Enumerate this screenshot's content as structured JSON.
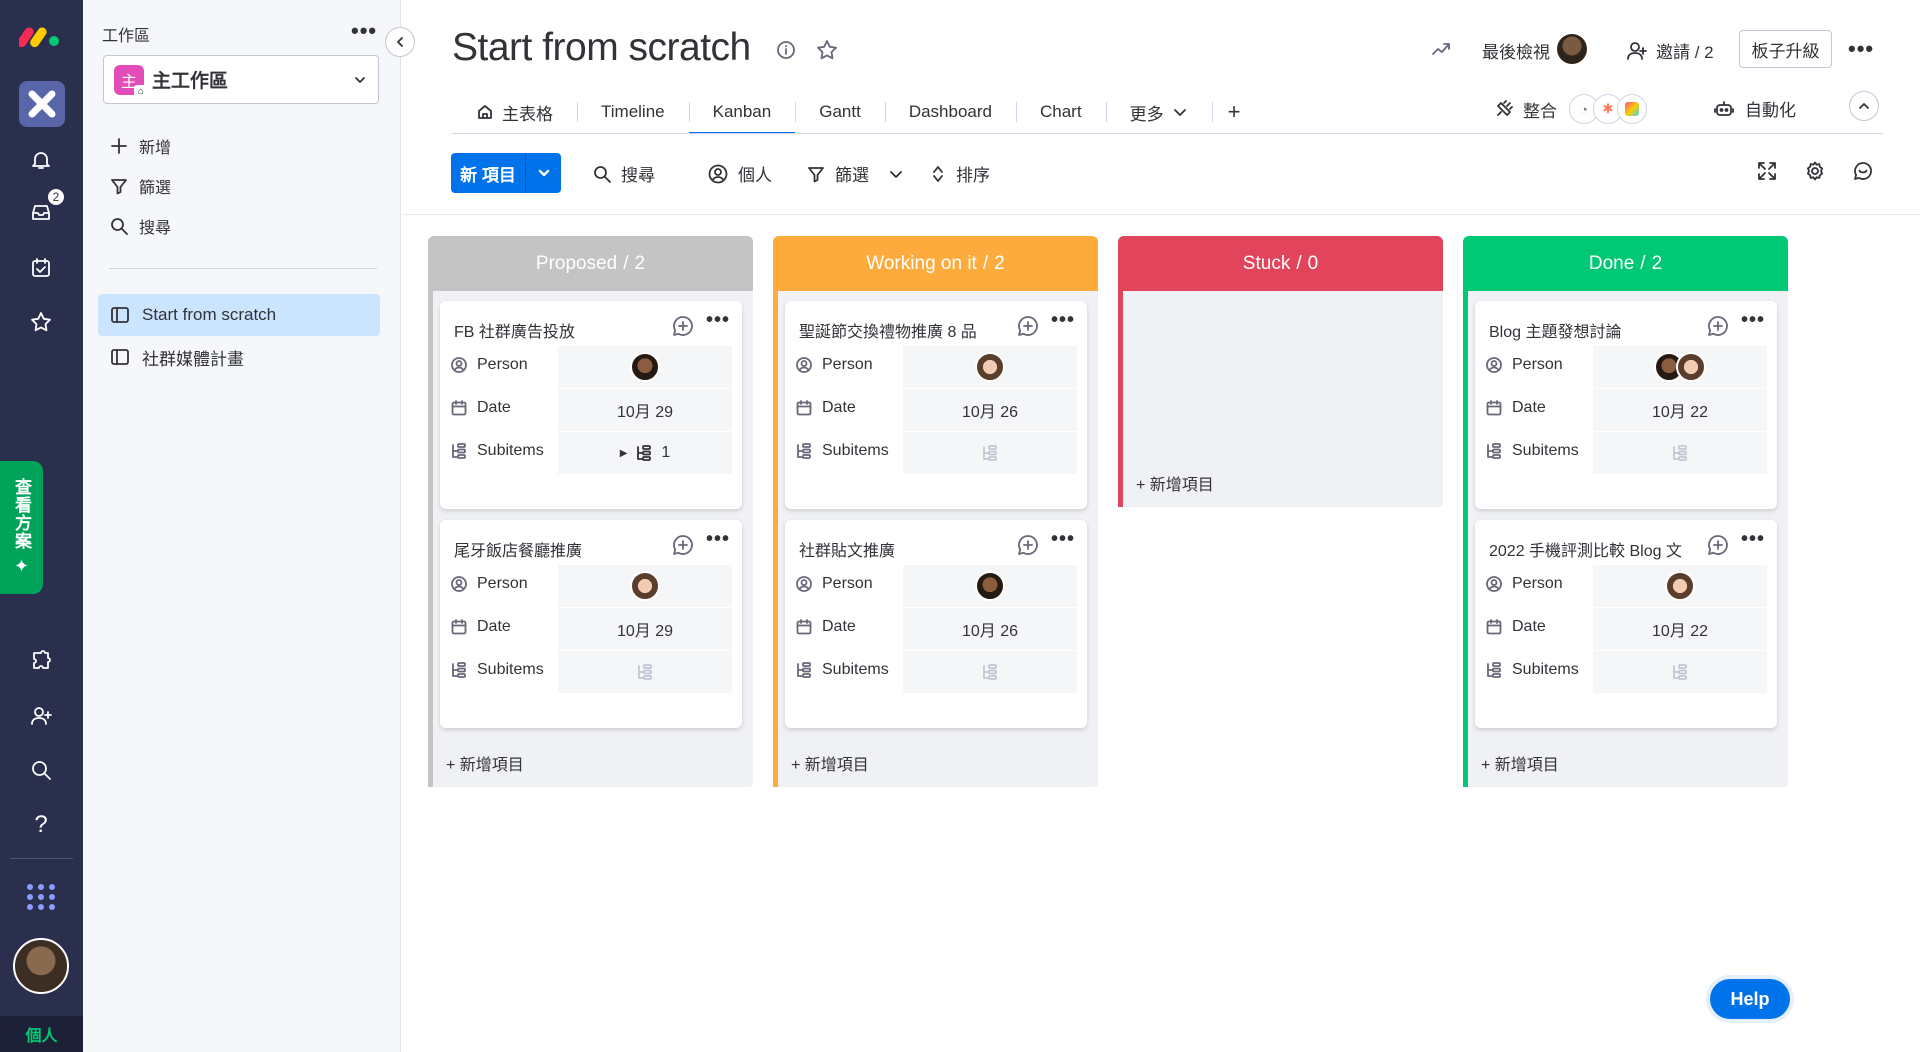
{
  "rail": {
    "notifications_badge": "2",
    "plans_label": "查看方案",
    "mode_label": "個人"
  },
  "panel": {
    "heading": "工作區",
    "more": "•••",
    "workspace_initial": "主",
    "workspace_name": "主工作區",
    "actions": {
      "add": "新增",
      "filter": "篩選",
      "search": "搜尋"
    },
    "boards": [
      {
        "label": "Start from scratch",
        "active": true
      },
      {
        "label": "社群媒體計畫",
        "active": false
      }
    ]
  },
  "header": {
    "title": "Start from scratch",
    "last_viewed": "最後檢視",
    "invite": "邀請 / 2",
    "upgrade": "板子升級",
    "more": "•••"
  },
  "tabs": [
    {
      "label": "主表格",
      "icon": "home-icon"
    },
    {
      "label": "Timeline"
    },
    {
      "label": "Kanban",
      "active": true
    },
    {
      "label": "Gantt"
    },
    {
      "label": "Dashboard"
    },
    {
      "label": "Chart"
    },
    {
      "label": "更多",
      "icon": "chevron-down-icon"
    },
    {
      "label": "+"
    }
  ],
  "integrations": {
    "label": "整合"
  },
  "automations": {
    "label": "自動化"
  },
  "toolbar": {
    "new_item": "新 項目",
    "search": "搜尋",
    "person": "個人",
    "filter": "篩選",
    "sort": "排序"
  },
  "colors": {
    "proposed": "#c4c4c4",
    "working": "#fdab3d",
    "stuck": "#e2445c",
    "done": "#00c875",
    "primary": "#0073ea"
  },
  "kanban": {
    "field_labels": {
      "person": "Person",
      "date": "Date",
      "subitems": "Subitems"
    },
    "add_item": "+ 新增項目",
    "columns": [
      {
        "name": "Proposed",
        "count": "2",
        "cards": [
          {
            "title": "FB 社群廣告投放",
            "people": [
              "dark"
            ],
            "date": "10月 29",
            "subitems": "1"
          },
          {
            "title": "尾牙飯店餐廳推廣",
            "people": [
              "light"
            ],
            "date": "10月 29",
            "subitems": ""
          }
        ]
      },
      {
        "name": "Working on it",
        "count": "2",
        "cards": [
          {
            "title": "聖誕節交換禮物推廣 8 品",
            "people": [
              "light"
            ],
            "date": "10月 26",
            "subitems": ""
          },
          {
            "title": "社群貼文推廣",
            "people": [
              "dark"
            ],
            "date": "10月 26",
            "subitems": ""
          }
        ]
      },
      {
        "name": "Stuck",
        "count": "0",
        "cards": []
      },
      {
        "name": "Done",
        "count": "2",
        "cards": [
          {
            "title": "Blog 主題發想討論",
            "people": [
              "dark",
              "light"
            ],
            "date": "10月 22",
            "subitems": ""
          },
          {
            "title": "2022 手機評測比較 Blog 文",
            "people": [
              "light"
            ],
            "date": "10月 22",
            "subitems": ""
          }
        ]
      }
    ]
  },
  "help": "Help"
}
